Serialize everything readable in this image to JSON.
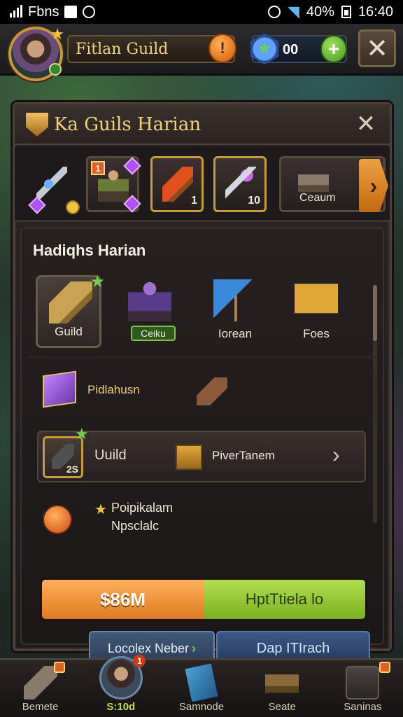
{
  "status_bar": {
    "carrier": "Fbns",
    "battery": "40%",
    "time": "16:40"
  },
  "top_bar": {
    "guild_name": "Fitlan Guild",
    "gem_count": "00",
    "add_symbol": "+",
    "close_symbol": "✕"
  },
  "panel": {
    "title": "Ka Guils Harian",
    "close_symbol": "✕"
  },
  "item_strip": {
    "slots": [
      {
        "icon": "crossbow-icon",
        "count": ""
      },
      {
        "icon": "hero-icon",
        "count": "",
        "badge": "1"
      },
      {
        "icon": "torch-icon",
        "count": "1"
      },
      {
        "icon": "wand-icon",
        "count": "10"
      }
    ],
    "wide_slot_label": "Ceaum",
    "arrow": "›"
  },
  "section": {
    "title": "Hadiqhs Harian",
    "categories": [
      {
        "label": "Guild",
        "icon": "horn-icon"
      },
      {
        "label": "Ceiku",
        "icon": "dark-hero-icon"
      },
      {
        "label": "Iorean",
        "icon": "flag-icon"
      },
      {
        "label": "Foes",
        "icon": "chest-icon"
      }
    ],
    "reward_text": "Pidlahusn",
    "guild_row": {
      "label": "Uuild",
      "count": "2S",
      "text": "PiverTanem",
      "arrow": "›"
    },
    "orb_text_1": "Poipikalam",
    "orb_text_2": "Npsclalc",
    "progress": {
      "left_text": "$86M",
      "right_text": "HptTtiela lo",
      "fraction": 0.5
    },
    "button_left": "Locolex Neber",
    "button_right": "Dap ITIrach"
  },
  "bottom_nav": [
    {
      "label": "Bemete",
      "icon": "hammer-icon"
    },
    {
      "label": "S:10d",
      "icon": "avatar-icon",
      "active": true,
      "badge": "1"
    },
    {
      "label": "Samnode",
      "icon": "card-icon"
    },
    {
      "label": "Seate",
      "icon": "anvil-icon"
    },
    {
      "label": "Saninas",
      "icon": "shop-icon"
    }
  ]
}
